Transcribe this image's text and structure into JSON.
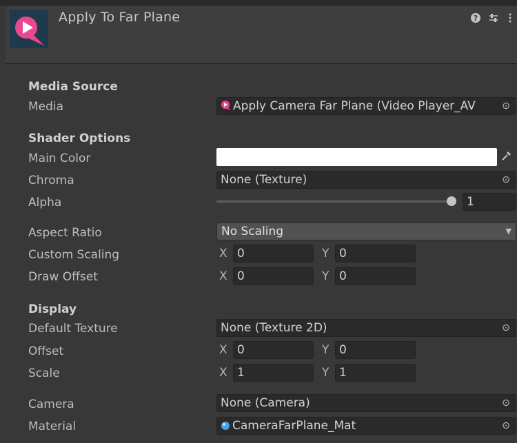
{
  "header": {
    "title": "Apply To Far Plane",
    "help_icon": "help-icon",
    "preset_icon": "presets-icon",
    "menu_icon": "kebab-menu-icon",
    "logo_colors": {
      "background": "#1f3a4c",
      "accent": "#e8488e"
    }
  },
  "media_source": {
    "section_label": "Media Source",
    "media_label": "Media",
    "media_value": "Apply Camera Far Plane (Video Player_AV"
  },
  "shader_options": {
    "section_label": "Shader Options",
    "main_color_label": "Main Color",
    "main_color_value": "#ffffff",
    "chroma_label": "Chroma",
    "chroma_value": "None (Texture)",
    "alpha_label": "Alpha",
    "alpha_value": "1",
    "alpha_slider_fraction": 1.0
  },
  "scaling": {
    "aspect_label": "Aspect Ratio",
    "aspect_value": "No Scaling",
    "custom_scaling_label": "Custom Scaling",
    "custom_x": "0",
    "custom_y": "0",
    "draw_offset_label": "Draw Offset",
    "draw_x": "0",
    "draw_y": "0"
  },
  "display": {
    "section_label": "Display",
    "default_texture_label": "Default Texture",
    "default_texture_value": "None (Texture 2D)",
    "offset_label": "Offset",
    "offset_x": "0",
    "offset_y": "0",
    "scale_label": "Scale",
    "scale_x": "1",
    "scale_y": "1"
  },
  "camera": {
    "camera_label": "Camera",
    "camera_value": "None (Camera)",
    "material_label": "Material",
    "material_value": "CameraFarPlane_Mat"
  },
  "axis_labels": {
    "x": "X",
    "y": "Y"
  }
}
